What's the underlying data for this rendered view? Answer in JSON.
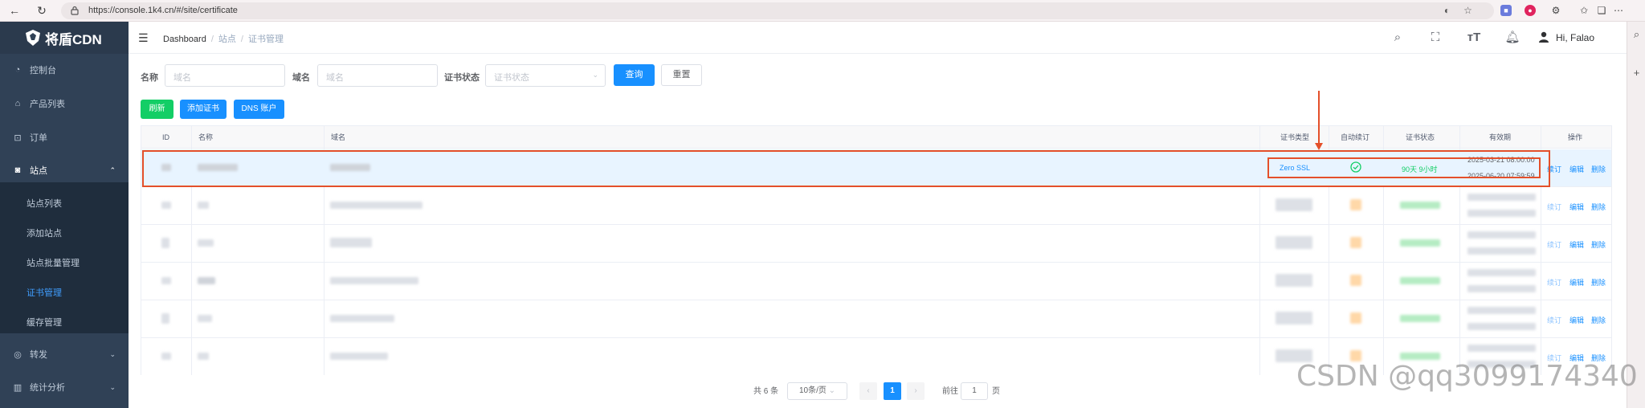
{
  "browser": {
    "url": "https://console.1k4.cn/#/site/certificate"
  },
  "sidebar": {
    "brand": "将盾CDN",
    "items": [
      {
        "label": "控制台",
        "icon": "dashboard-icon"
      },
      {
        "label": "产品列表",
        "icon": "store-icon"
      },
      {
        "label": "订单",
        "icon": "cart-icon"
      },
      {
        "label": "站点",
        "icon": "site-icon",
        "arrow": "⌃"
      },
      {
        "label": "转发",
        "icon": "forward-icon",
        "arrow": "⌄"
      },
      {
        "label": "统计分析",
        "icon": "chart-icon",
        "arrow": "⌄"
      }
    ],
    "sub_items": [
      {
        "label": "站点列表"
      },
      {
        "label": "添加站点"
      },
      {
        "label": "站点批量管理"
      },
      {
        "label": "证书管理"
      },
      {
        "label": "缓存管理"
      }
    ]
  },
  "header": {
    "breadcrumb": [
      "Dashboard",
      "站点",
      "证书管理"
    ],
    "user": "Hi, Falao"
  },
  "filters": {
    "name_label": "名称",
    "name_placeholder": "域名",
    "domain_label": "域名",
    "domain_placeholder": "域名",
    "status_label": "证书状态",
    "status_placeholder": "证书状态",
    "query": "查询",
    "reset": "重置"
  },
  "actions": {
    "refresh": "刷新",
    "add_cert": "添加证书",
    "dns": "DNS 账户"
  },
  "table": {
    "columns": [
      "ID",
      "名称",
      "域名",
      "证书类型",
      "自动续订",
      "证书状态",
      "有效期",
      "操作"
    ],
    "first_row": {
      "cert_type": "Zero SSL",
      "status": "90天 9小时",
      "valid_from": "2025-03-21 08:00:00",
      "valid_to": "2025-06-20 07:59:59"
    },
    "row_actions": {
      "renew": "续订",
      "edit": "编辑",
      "delete": "删除"
    }
  },
  "pagination": {
    "total": "共 6 条",
    "page_size": "10条/页",
    "current": "1",
    "goto_label": "前往",
    "goto_value": "1",
    "page_unit": "页"
  },
  "watermark": "CSDN @qq3099174340",
  "colors": {
    "sidebar_bg": "#304156",
    "accent": "#1890ff",
    "annotation": "#e4502a"
  }
}
